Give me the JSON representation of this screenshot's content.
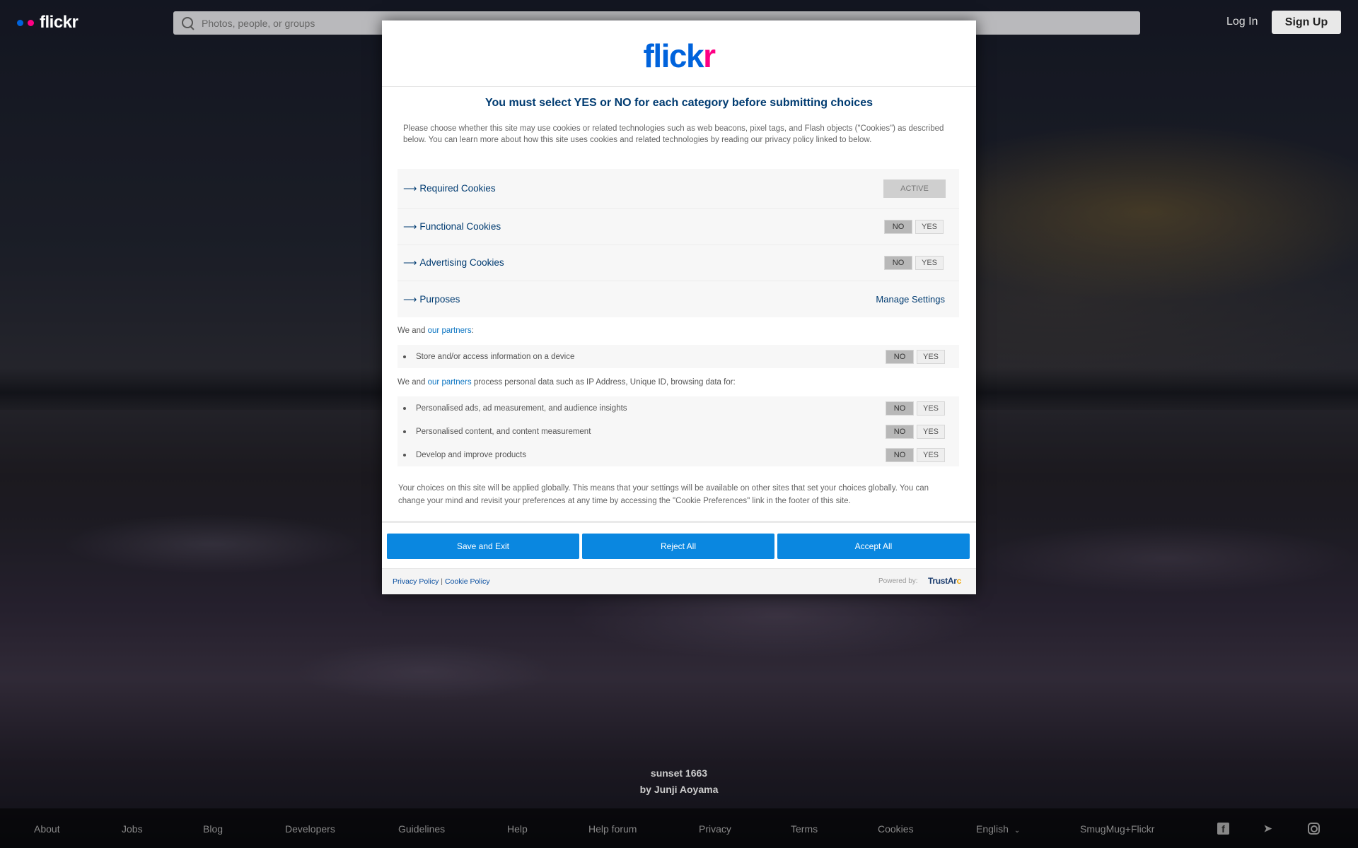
{
  "header": {
    "logo_text": "flickr",
    "search_placeholder": "Photos, people, or groups",
    "login_label": "Log In",
    "signup_label": "Sign Up"
  },
  "photo": {
    "title": "sunset 1663",
    "author": "by Junji Aoyama"
  },
  "footer": {
    "links": [
      "About",
      "Jobs",
      "Blog",
      "Developers",
      "Guidelines",
      "Help",
      "Help forum",
      "Privacy",
      "Terms",
      "Cookies"
    ],
    "language": "English",
    "brand_link": "SmugMug+Flickr",
    "social_icons": [
      "facebook-icon",
      "twitter-icon",
      "instagram-icon"
    ]
  },
  "modal": {
    "logo_main": "flick",
    "logo_accent": "r",
    "title": "You must select YES or NO for each category before submitting choices",
    "intro": "Please choose whether this site may use cookies or related technologies such as web beacons, pixel tags, and Flash objects (\"Cookies\") as described below. You can learn more about how this site uses cookies and related technologies by reading our privacy policy linked to below.",
    "arrow": "⟶",
    "categories": [
      {
        "name": "Required Cookies",
        "status": "ACTIVE"
      },
      {
        "name": "Functional Cookies",
        "no": "NO",
        "yes": "YES"
      },
      {
        "name": "Advertising Cookies",
        "no": "NO",
        "yes": "YES"
      },
      {
        "name": "Purposes",
        "action": "Manage Settings"
      }
    ],
    "partners_prefix": "We and ",
    "partners_link": "our partners",
    "partners_suffix_1": ":",
    "partners_suffix_2": " process personal data such as IP Address, Unique ID, browsing data for:",
    "purposes_1": [
      {
        "text": "Store and/or access information on a device",
        "no": "NO",
        "yes": "YES"
      }
    ],
    "purposes_2": [
      {
        "text": "Personalised ads, ad measurement, and audience insights",
        "no": "NO",
        "yes": "YES"
      },
      {
        "text": "Personalised content, and content measurement",
        "no": "NO",
        "yes": "YES"
      },
      {
        "text": "Develop and improve products",
        "no": "NO",
        "yes": "YES"
      }
    ],
    "global_note": "Your choices on this site will be applied globally. This means that your settings will be available on other sites that set your choices globally. You can change your mind and revisit your preferences at any time by accessing the \"Cookie Preferences\" link in the footer of this site.",
    "buttons": {
      "save": "Save and Exit",
      "reject": "Reject All",
      "accept": "Accept All"
    },
    "footer": {
      "privacy_link": "Privacy Policy",
      "separator": "|",
      "cookie_link": "Cookie Policy",
      "powered_by": "Powered by:",
      "vendor_main": "TrustAr",
      "vendor_accent": "c"
    }
  },
  "colors": {
    "flickr_blue": "#0063dc",
    "flickr_pink": "#ff0084",
    "button_blue": "#0a87e0",
    "heading_navy": "#003b71"
  }
}
